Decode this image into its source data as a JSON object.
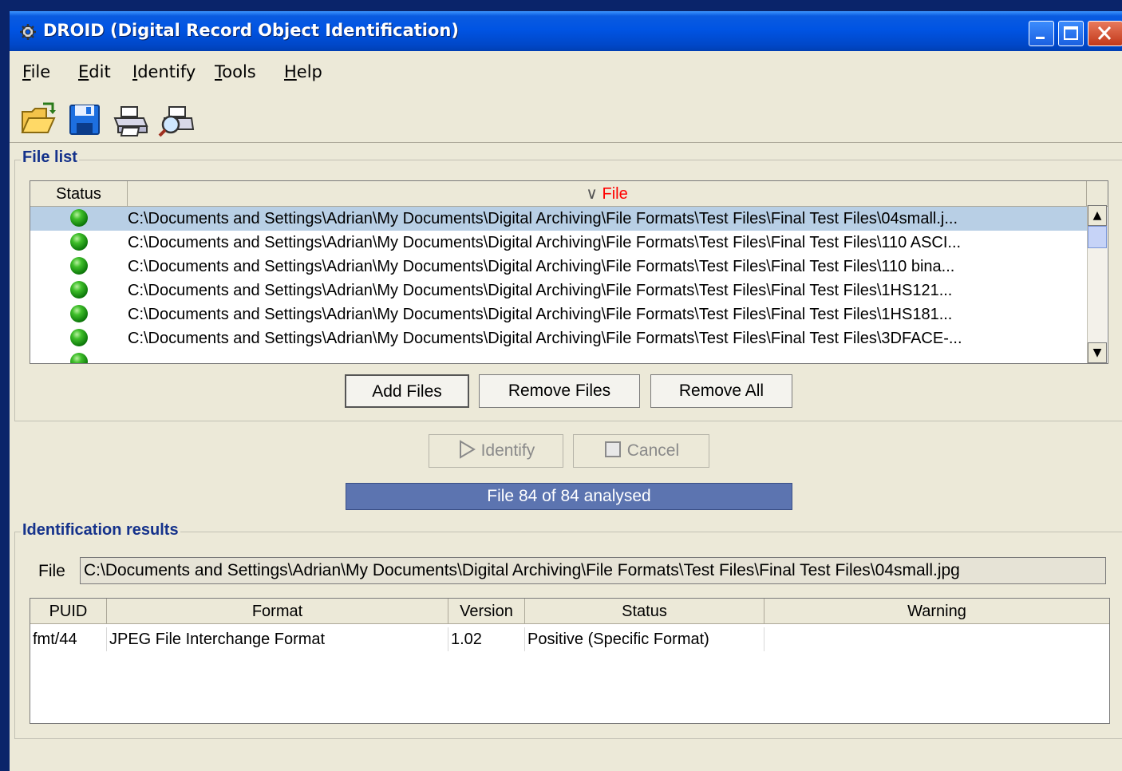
{
  "window": {
    "title": "DROID (Digital Record Object Identification)"
  },
  "menu": [
    {
      "label": "File"
    },
    {
      "label": "Edit"
    },
    {
      "label": "Identify"
    },
    {
      "label": "Tools"
    },
    {
      "label": "Help"
    }
  ],
  "toolbar": {
    "icons": [
      "open-folder-icon",
      "save-icon",
      "print-icon",
      "print-preview-icon"
    ]
  },
  "file_list": {
    "group_label": "File list",
    "columns": {
      "status": "Status",
      "file": "File"
    },
    "sort_indicator": "∨",
    "rows": [
      {
        "status": "green",
        "file": "C:\\Documents and Settings\\Adrian\\My Documents\\Digital Archiving\\File Formats\\Test Files\\Final Test Files\\04small.j..."
      },
      {
        "status": "green",
        "file": "C:\\Documents and Settings\\Adrian\\My Documents\\Digital Archiving\\File Formats\\Test Files\\Final Test Files\\110 ASCI..."
      },
      {
        "status": "green",
        "file": "C:\\Documents and Settings\\Adrian\\My Documents\\Digital Archiving\\File Formats\\Test Files\\Final Test Files\\110 bina..."
      },
      {
        "status": "green",
        "file": "C:\\Documents and Settings\\Adrian\\My Documents\\Digital Archiving\\File Formats\\Test Files\\Final Test Files\\1HS121..."
      },
      {
        "status": "green",
        "file": "C:\\Documents and Settings\\Adrian\\My Documents\\Digital Archiving\\File Formats\\Test Files\\Final Test Files\\1HS181..."
      },
      {
        "status": "green",
        "file": "C:\\Documents and Settings\\Adrian\\My Documents\\Digital Archiving\\File Formats\\Test Files\\Final Test Files\\3DFACE-..."
      }
    ],
    "buttons": {
      "add": "Add Files",
      "remove": "Remove Files",
      "remove_all": "Remove All"
    }
  },
  "actions": {
    "identify": "Identify",
    "cancel": "Cancel"
  },
  "progress": {
    "text": "File 84 of 84 analysed",
    "fraction": 1.0
  },
  "results": {
    "group_label": "Identification results",
    "file_label": "File",
    "file_value": "C:\\Documents and Settings\\Adrian\\My Documents\\Digital Archiving\\File Formats\\Test Files\\Final Test Files\\04small.jpg",
    "columns": {
      "puid": "PUID",
      "format": "Format",
      "version": "Version",
      "status": "Status",
      "warning": "Warning"
    },
    "rows": [
      {
        "puid": "fmt/44",
        "format": "JPEG File Interchange Format",
        "version": "1.02",
        "status": "Positive (Specific Format)",
        "warning": ""
      }
    ]
  },
  "colors": {
    "titlebar": "#0054e3",
    "selection": "#b8cfe5",
    "progress": "#5c74b0",
    "group_label": "#15328b",
    "sort_header": "#ff0000"
  }
}
